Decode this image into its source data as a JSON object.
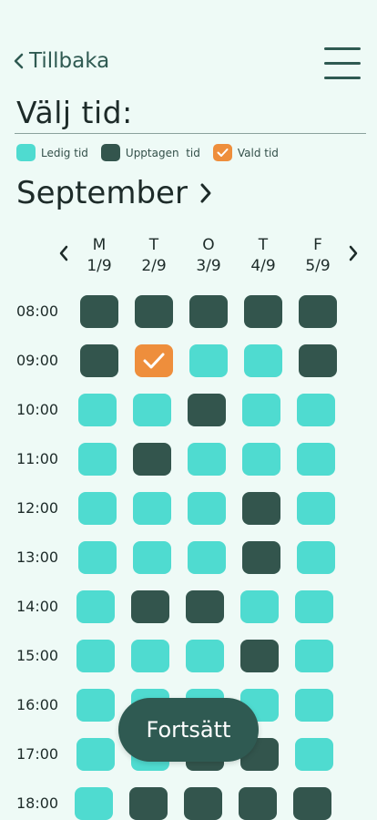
{
  "header": {
    "back_label": "Tillbaka",
    "title": "Välj tid:"
  },
  "legend": {
    "free_label": "Ledig tid",
    "busy_label": "Upptagen  tid",
    "chosen_label": "Vald tid"
  },
  "calendar": {
    "month": "September",
    "days": [
      {
        "letter": "M",
        "date": "1/9"
      },
      {
        "letter": "T",
        "date": "2/9"
      },
      {
        "letter": "O",
        "date": "3/9"
      },
      {
        "letter": "T",
        "date": "4/9"
      },
      {
        "letter": "F",
        "date": "5/9"
      }
    ],
    "times": [
      "08:00",
      "09:00",
      "10:00",
      "11:00",
      "12:00",
      "13:00",
      "14:00",
      "15:00",
      "16:00",
      "17:00",
      "18:00"
    ],
    "slots": [
      [
        "busy",
        "busy",
        "busy",
        "busy",
        "busy"
      ],
      [
        "busy",
        "chosen",
        "free",
        "free",
        "busy"
      ],
      [
        "free",
        "free",
        "busy",
        "free",
        "free"
      ],
      [
        "free",
        "busy",
        "free",
        "free",
        "free"
      ],
      [
        "free",
        "free",
        "free",
        "busy",
        "free"
      ],
      [
        "free",
        "free",
        "free",
        "busy",
        "free"
      ],
      [
        "free",
        "busy",
        "busy",
        "free",
        "free"
      ],
      [
        "free",
        "free",
        "free",
        "busy",
        "free"
      ],
      [
        "free",
        "free",
        "free",
        "free",
        "free"
      ],
      [
        "free",
        "free",
        "busy",
        "busy",
        "free"
      ],
      [
        "free",
        "busy",
        "busy",
        "busy",
        "busy"
      ]
    ]
  },
  "actions": {
    "continue_label": "Fortsätt"
  },
  "colors": {
    "free": "#4fdbd0",
    "busy": "#33554d",
    "chosen": "#ee8e3c",
    "background": "#eefaf6"
  }
}
